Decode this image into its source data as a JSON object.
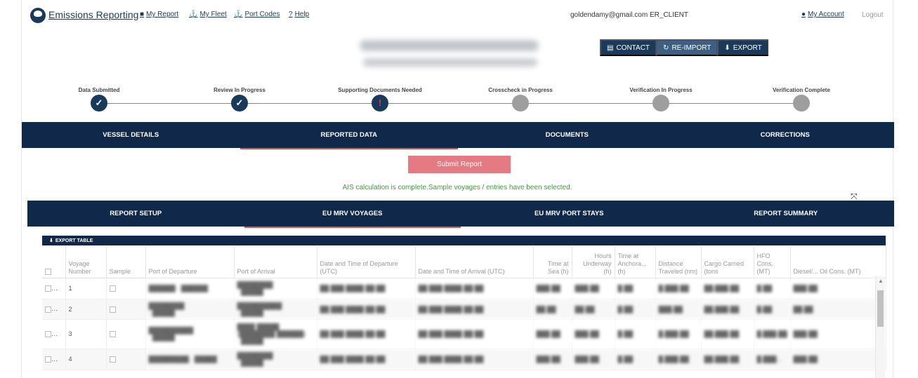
{
  "header": {
    "brand": "Emissions Reporting",
    "nav": [
      {
        "icon": "■",
        "label": "My Report"
      },
      {
        "icon": "⚓",
        "label": "My Fleet"
      },
      {
        "icon": "⚓",
        "label": "Port Codes"
      },
      {
        "icon": "?",
        "label": "Help"
      }
    ],
    "user": "goldendamy@gmail.com ER_CLIENT",
    "account_label": "My Account",
    "logout_label": "Logout"
  },
  "actions": {
    "contact": "CONTACT",
    "reimport": "RE-IMPORT",
    "export": "EXPORT"
  },
  "progress": {
    "steps": [
      {
        "label": "Data Submitted",
        "status": "done",
        "glyph": "✓"
      },
      {
        "label": "Review In Progress",
        "status": "done",
        "glyph": "✓"
      },
      {
        "label": "Supporting Documents Needed",
        "status": "warning",
        "glyph": "!"
      },
      {
        "label": "Crosscheck in Progress",
        "status": "pending",
        "glyph": ""
      },
      {
        "label": "Verification In Progress",
        "status": "pending",
        "glyph": ""
      },
      {
        "label": "Verification Complete",
        "status": "pending",
        "glyph": ""
      }
    ]
  },
  "main_tabs": [
    "VESSEL DETAILS",
    "REPORTED DATA",
    "DOCUMENTS",
    "CORRECTIONS"
  ],
  "main_tab_active": 1,
  "submit_label": "Submit Report",
  "message": "AIS calculation is complete.Sample voyages / entries have been selected.",
  "sub_tabs": [
    "REPORT SETUP",
    "EU MRV VOYAGES",
    "EU MRV PORT STAYS",
    "REPORT SUMMARY"
  ],
  "sub_tab_active": 1,
  "table": {
    "export_label": "EXPORT TABLE",
    "columns": {
      "voyage_number": "Voyage Number",
      "sample": "Sample",
      "port_departure": "Port of Departure",
      "port_arrival": "Port of Arrival",
      "date_departure": "Date and Time of Departure (UTC)",
      "date_arrival": "Date and Time of Arrival (UTC)",
      "time_sea": "Time at Sea (h)",
      "hours_underway": "Hours Underway (h)",
      "time_anchor": "Time at Anchora... (h)",
      "distance": "Distance Traveled (nm)",
      "cargo": "Cargo Carried (tons",
      "hfo": "HFO Cons. (MT)",
      "diesel": "Diesel/... Oil Cons. (MT)"
    },
    "rows": [
      {
        "voyage_number": "1"
      },
      {
        "voyage_number": "2"
      },
      {
        "voyage_number": "3"
      },
      {
        "voyage_number": "4"
      }
    ]
  },
  "colors": {
    "navy": "#10284a",
    "accent_red": "#d9534f",
    "submit_pink": "#e57a83",
    "success_green": "#3c9c3c"
  }
}
